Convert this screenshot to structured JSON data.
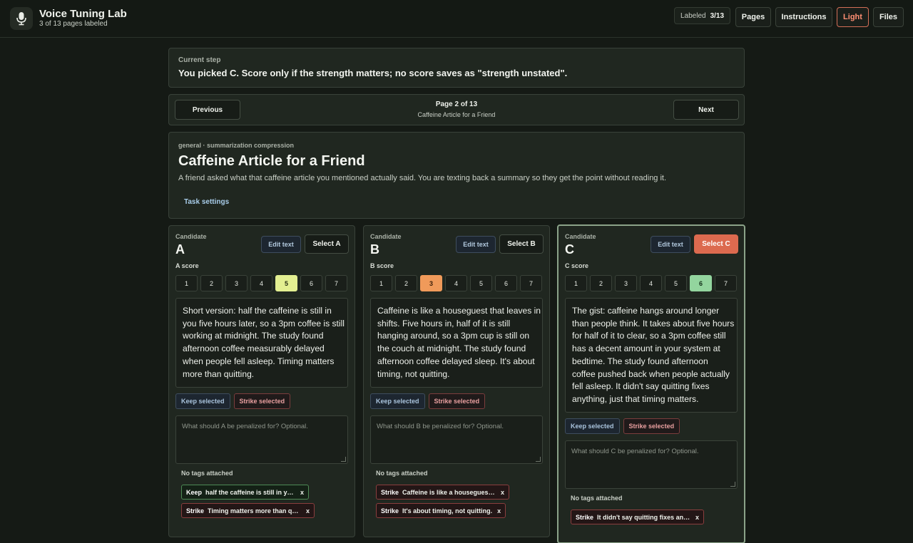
{
  "app": {
    "title": "Voice Tuning Lab",
    "subtitle": "3 of 13 pages labeled",
    "labeled_label": "Labeled",
    "labeled_value": "3/13",
    "buttons": [
      "Pages",
      "Instructions",
      "Light",
      "Files"
    ]
  },
  "step": {
    "label": "Current step",
    "text": "You picked C. Score only if the strength matters; no score saves as \"strength unstated\"."
  },
  "pager": {
    "previous": "Previous",
    "next": "Next",
    "page": "Page 2 of 13",
    "page_title": "Caffeine Article for a Friend"
  },
  "task": {
    "meta": "general · summarization compression",
    "title": "Caffeine Article for a Friend",
    "description": "A friend asked what that caffeine article you mentioned actually said. You are texting back a summary so they get the point without reading it.",
    "settings_label": "Task settings"
  },
  "candidate_label": "Candidate",
  "edit_label": "Edit text",
  "keep_label": "Keep selected",
  "strike_label": "Strike selected",
  "no_tags": "No tags attached",
  "candidates": [
    {
      "letter": "A",
      "select_label": "Select A",
      "score_label": "A score",
      "scores": [
        "1",
        "2",
        "3",
        "4",
        "5",
        "6",
        "7"
      ],
      "selected_score": "5",
      "text_lines": [
        "Short version: half the caffeine is still in",
        "you five hours later, so a 3pm coffee is still",
        "working at midnight. The study found",
        "afternoon coffee measurably delayed",
        "when people fell asleep. Timing matters",
        "more than quitting."
      ],
      "note_placeholder": "What should A be penalized for? Optional.",
      "tags": [
        {
          "kind": "Keep",
          "text": "half the caffeine is still in you five hours later",
          "x": "x"
        },
        {
          "kind": "Strike",
          "text": "Timing matters more than quitting.",
          "x": "x"
        }
      ]
    },
    {
      "letter": "B",
      "select_label": "Select B",
      "score_label": "B score",
      "scores": [
        "1",
        "2",
        "3",
        "4",
        "5",
        "6",
        "7"
      ],
      "selected_score": "3",
      "text_lines": [
        "Caffeine is like a houseguest that leaves in",
        "shifts. Five hours in, half of it is still",
        "hanging around, so a 3pm cup is still on",
        "the couch at midnight. The study found",
        "afternoon coffee delayed sleep. It's about",
        "timing, not quitting."
      ],
      "note_placeholder": "What should B be penalized for? Optional.",
      "tags": [
        {
          "kind": "Strike",
          "text": "Caffeine is like a houseguest that leaves in shifts.",
          "x": "x"
        },
        {
          "kind": "Strike",
          "text": "It's about timing, not quitting.",
          "x": "x"
        }
      ]
    },
    {
      "letter": "C",
      "select_label": "Select C",
      "score_label": "C score",
      "scores": [
        "1",
        "2",
        "3",
        "4",
        "5",
        "6",
        "7"
      ],
      "selected_score": "6",
      "text_lines": [
        "The gist: caffeine hangs around longer",
        "than people think. It takes about five hours",
        "for half of it to clear, so a 3pm coffee still",
        "has a decent amount in your system at",
        "bedtime. The study found afternoon",
        "coffee pushed back when people actually",
        "fell asleep. It didn't say quitting fixes",
        "anything, just that timing matters."
      ],
      "note_placeholder": "What should C be penalized for? Optional.",
      "tags": [
        {
          "kind": "Strike",
          "text": "It didn't say quitting fixes anything",
          "x": "x"
        }
      ]
    }
  ]
}
